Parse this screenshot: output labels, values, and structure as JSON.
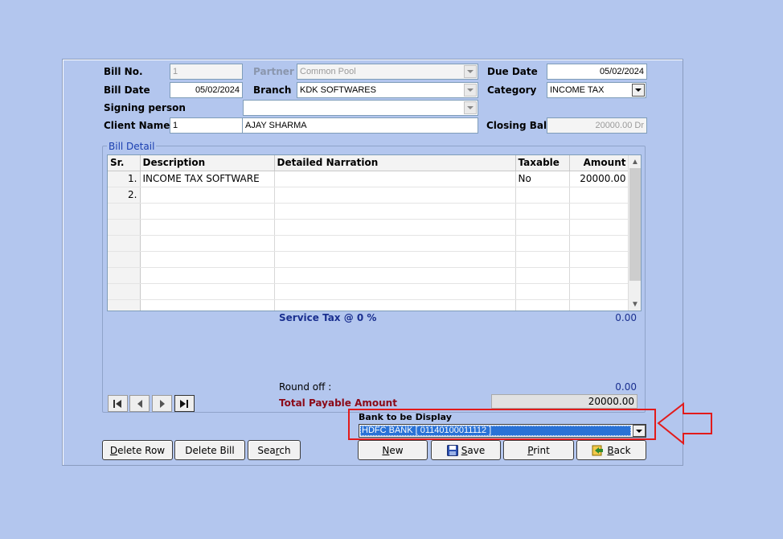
{
  "header": {
    "bill_no_label": "Bill No.",
    "bill_no": "1",
    "partner_label": "Partner",
    "partner": "Common Pool",
    "due_date_label": "Due Date",
    "due_date": "05/02/2024",
    "bill_date_label": "Bill Date",
    "bill_date": "05/02/2024",
    "branch_label": "Branch",
    "branch": "KDK SOFTWARES",
    "category_label": "Category",
    "category": "INCOME TAX",
    "signing_label": "Signing person",
    "signing": "",
    "client_label": "Client Name",
    "client_code": "1",
    "client_name": "AJAY SHARMA",
    "closing_label": "Closing Bal.",
    "closing_bal": "20000.00 Dr"
  },
  "bill_detail": {
    "legend": "Bill Detail",
    "columns": [
      "Sr.",
      "Description",
      "Detailed Narration",
      "Taxable",
      "Amount"
    ],
    "rows": [
      {
        "sr": "1.",
        "description": "INCOME TAX SOFTWARE",
        "narration": "",
        "taxable": "No",
        "amount": "20000.00"
      },
      {
        "sr": "2.",
        "description": "",
        "narration": "",
        "taxable": "",
        "amount": ""
      },
      {
        "sr": "",
        "description": "",
        "narration": "",
        "taxable": "",
        "amount": ""
      },
      {
        "sr": "",
        "description": "",
        "narration": "",
        "taxable": "",
        "amount": ""
      },
      {
        "sr": "",
        "description": "",
        "narration": "",
        "taxable": "",
        "amount": ""
      },
      {
        "sr": "",
        "description": "",
        "narration": "",
        "taxable": "",
        "amount": ""
      },
      {
        "sr": "",
        "description": "",
        "narration": "",
        "taxable": "",
        "amount": ""
      },
      {
        "sr": "",
        "description": "",
        "narration": "",
        "taxable": "",
        "amount": ""
      },
      {
        "sr": "",
        "description": "",
        "narration": "",
        "taxable": "",
        "amount": ""
      }
    ]
  },
  "summary": {
    "service_tax_label": "Service Tax @ 0 %",
    "service_tax": "0.00",
    "round_off_label": "Round off :",
    "round_off": "0.00",
    "total_label": "Total Payable Amount",
    "total": "20000.00"
  },
  "bank": {
    "label": "Bank to be Display",
    "value": "HDFC BANK [ 01140100011112 ]"
  },
  "buttons": {
    "delete_row": {
      "first": "D",
      "rest": "elete Row"
    },
    "delete_bill": "Delete Bill",
    "search": {
      "pre": "Sea",
      "u": "r",
      "post": "ch"
    },
    "new": {
      "u": "N",
      "rest": "ew"
    },
    "save": {
      "u": "S",
      "rest": "ave"
    },
    "print": {
      "u": "P",
      "rest": "rint"
    },
    "back": {
      "u": "B",
      "rest": "ack"
    }
  },
  "colors": {
    "background": "#b3c6ee",
    "highlight": "#e21b1b",
    "selection": "#2a72d6"
  }
}
